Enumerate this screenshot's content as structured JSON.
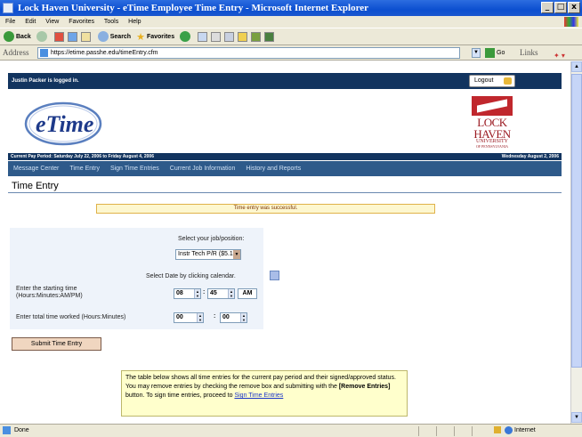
{
  "window": {
    "title": "Lock Haven University - eTime Employee Time Entry - Microsoft Internet Explorer",
    "controls": [
      "_",
      "□",
      "x"
    ]
  },
  "menu": [
    "File",
    "Edit",
    "View",
    "Favorites",
    "Tools",
    "Help"
  ],
  "toolbar": {
    "back": "Back",
    "search": "Search",
    "favorites": "Favorites"
  },
  "address": {
    "label": "Address",
    "url": "https://etime.passhe.edu/timeEntry.cfm",
    "go": "Go",
    "links": "Links"
  },
  "page": {
    "logged_in": "Justin Packer is logged in.",
    "logout": "Logout",
    "logo": "eTime",
    "univ_logo": {
      "line1": "LOCK",
      "line2": "HAVEN",
      "line3": "UNIVERSITY",
      "line4": "OF PENNSYLVANIA"
    },
    "pay_period": "Current Pay Period: Saturday July 22, 2006 to Friday August 4, 2006",
    "today": "Wednesday August 2, 2006",
    "nav": [
      "Message Center",
      "Time Entry",
      "Sign Time Entries",
      "Current Job Information",
      "History and Reports"
    ],
    "section_title": "Time Entry",
    "success": "Time entry was successful.",
    "select_job_label": "Select your job/position:",
    "job_value": "Instr Tech P/R ($5.15.)",
    "select_date_label": "Select Date by clicking calendar.",
    "start_time_label_1": "Enter the starting time",
    "start_time_label_2": "(Hours:Minutes:AM/PM)",
    "start_hour": "08",
    "start_min": "45",
    "start_ampm": "AM",
    "total_label": "Enter total time worked (Hours:Minutes)",
    "total_hours": "00",
    "total_mins": "00",
    "time_sep": ":",
    "submit": "Submit Time Entry",
    "info_1": "The table below shows all time entries for the current pay period and their signed/approved status. You may remove entries by checking the remove box and submitting with the",
    "info_bold": "[Remove Entries]",
    "info_2": "button. To sign time entries, proceed to",
    "info_link": "Sign Time Entries"
  },
  "status": {
    "text": "Done",
    "zone": "Internet"
  }
}
